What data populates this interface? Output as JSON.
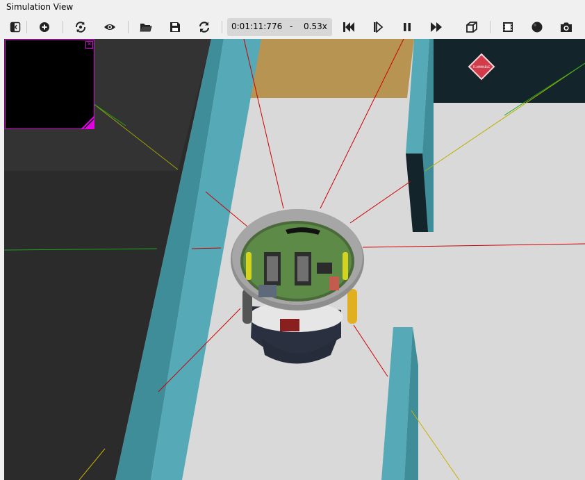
{
  "window": {
    "title": "Simulation View"
  },
  "toolbar": {
    "time": "0:01:11:776",
    "time_separator": "-",
    "speed": "0.53x",
    "buttons": [
      {
        "name": "scene-tree-toggle-icon"
      },
      {
        "name": "add-node-icon"
      },
      {
        "name": "viewpoint-reset-icon"
      },
      {
        "name": "view-eye-icon"
      },
      {
        "name": "open-world-icon"
      },
      {
        "name": "save-world-icon"
      },
      {
        "name": "reload-world-icon"
      },
      {
        "name": "reset-simulation-icon"
      },
      {
        "name": "step-icon"
      },
      {
        "name": "pause-icon"
      },
      {
        "name": "fast-forward-icon"
      },
      {
        "name": "3d-view-icon"
      },
      {
        "name": "record-movie-icon"
      },
      {
        "name": "record-animation-icon"
      },
      {
        "name": "screenshot-icon"
      }
    ]
  },
  "viewport": {
    "scene": "robot-arena",
    "hazard_sign_label": "FLAMMABLE",
    "colors": {
      "wall": "#56a9b6",
      "wall_shadow": "#3f8d99",
      "floor": "#d8d8d8",
      "dark_floor": "#2a2a2a",
      "orange_area": "#b89453",
      "dark_wall": "#13242a",
      "sensor_ray": "#cc0000",
      "minicam_border": "#e000e0"
    }
  }
}
